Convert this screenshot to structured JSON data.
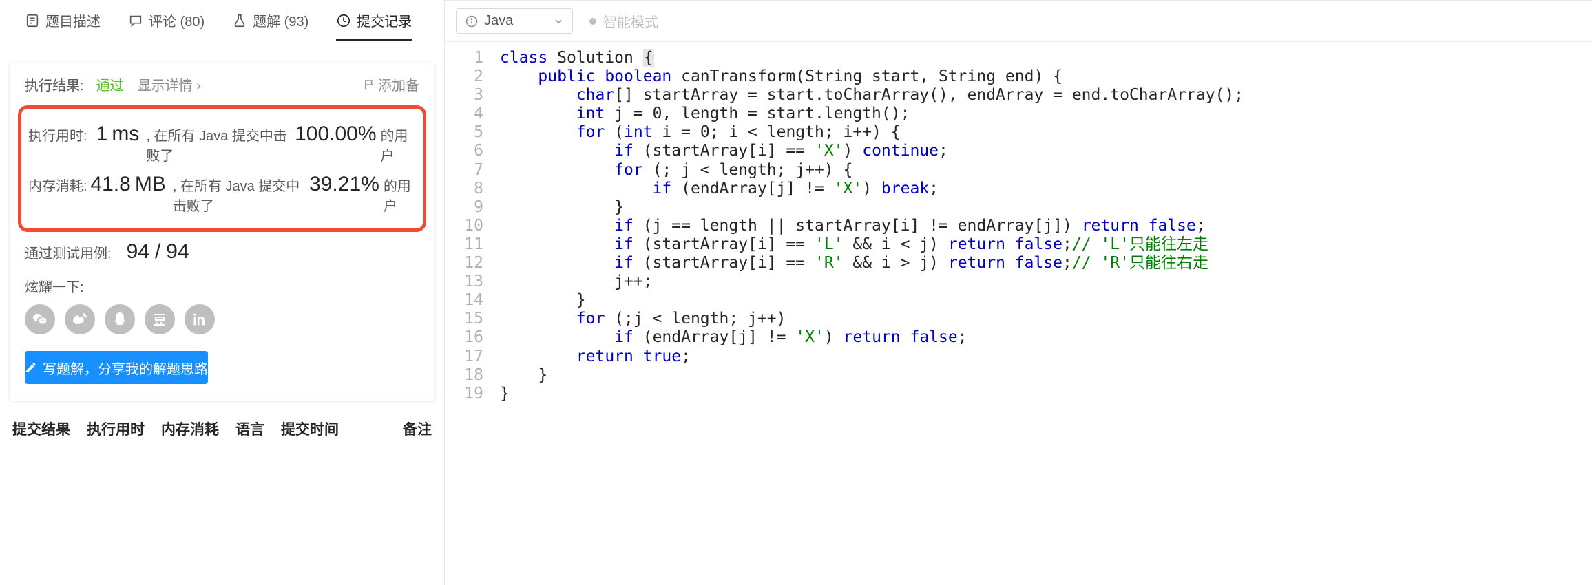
{
  "tabs": {
    "description": "题目描述",
    "comments": "评论 (80)",
    "solutions": "题解 (93)",
    "submissions": "提交记录"
  },
  "result": {
    "exec_label": "执行结果:",
    "status": "通过",
    "detail_link": "显示详情 ›",
    "add_note": "添加备",
    "runtime_label": "执行用时:",
    "runtime_value": "1",
    "runtime_unit": "ms",
    "runtime_text1": ", 在所有 Java 提交中击败了",
    "runtime_pct": "100.00%",
    "runtime_text2": "的用户",
    "memory_label": "内存消耗:",
    "memory_value": "41.8",
    "memory_unit": "MB",
    "memory_text1": ", 在所有 Java 提交中击败了",
    "memory_pct": "39.21%",
    "memory_text2": "的用户",
    "cases_label": "通过测试用例:",
    "cases_passed": "94",
    "cases_sep": "/",
    "cases_total": "94",
    "share_label": "炫耀一下:",
    "write_btn": "写题解，分享我的解题思路"
  },
  "history_columns": {
    "c1": "提交结果",
    "c2": "执行用时",
    "c3": "内存消耗",
    "c4": "语言",
    "c5": "提交时间",
    "c6": "备注"
  },
  "editor": {
    "language": "Java",
    "smart_mode": "智能模式"
  },
  "code_tokens": [
    [
      [
        "class ",
        "k-blue"
      ],
      [
        "Solution ",
        ""
      ],
      [
        "{",
        "k-curs"
      ]
    ],
    [
      [
        "    ",
        ""
      ],
      [
        "public ",
        "k-blue"
      ],
      [
        "boolean ",
        "k-blue"
      ],
      [
        "canTransform(String start, String end) {",
        ""
      ]
    ],
    [
      [
        "        ",
        ""
      ],
      [
        "char",
        "k-blue"
      ],
      [
        "[] startArray = start.toCharArray(), endArray = end.toCharArray();",
        ""
      ]
    ],
    [
      [
        "        ",
        ""
      ],
      [
        "int ",
        "k-blue"
      ],
      [
        "j = ",
        ""
      ],
      [
        "0",
        ""
      ],
      [
        ", length = start.length();",
        ""
      ]
    ],
    [
      [
        "        ",
        ""
      ],
      [
        "for ",
        "k-blue"
      ],
      [
        "(",
        ""
      ],
      [
        "int ",
        "k-blue"
      ],
      [
        "i = ",
        ""
      ],
      [
        "0",
        ""
      ],
      [
        "; i < length; i++) {",
        ""
      ]
    ],
    [
      [
        "            ",
        ""
      ],
      [
        "if ",
        "k-blue"
      ],
      [
        "(startArray[i] == ",
        ""
      ],
      [
        "'X'",
        "k-str"
      ],
      [
        ") ",
        ""
      ],
      [
        "continue",
        "k-blue"
      ],
      [
        ";",
        ""
      ]
    ],
    [
      [
        "            ",
        ""
      ],
      [
        "for ",
        "k-blue"
      ],
      [
        "(; j < length; j++) {",
        ""
      ]
    ],
    [
      [
        "                ",
        ""
      ],
      [
        "if ",
        "k-blue"
      ],
      [
        "(endArray[j] != ",
        ""
      ],
      [
        "'X'",
        "k-str"
      ],
      [
        ") ",
        ""
      ],
      [
        "break",
        "k-blue"
      ],
      [
        ";",
        ""
      ]
    ],
    [
      [
        "            }",
        ""
      ]
    ],
    [
      [
        "            ",
        ""
      ],
      [
        "if ",
        "k-blue"
      ],
      [
        "(j == length || startArray[i] != endArray[j]) ",
        ""
      ],
      [
        "return ",
        "k-blue"
      ],
      [
        "false",
        "k-blue"
      ],
      [
        ";",
        ""
      ]
    ],
    [
      [
        "            ",
        ""
      ],
      [
        "if ",
        "k-blue"
      ],
      [
        "(startArray[i] == ",
        ""
      ],
      [
        "'L'",
        "k-str"
      ],
      [
        " && i < j) ",
        ""
      ],
      [
        "return ",
        "k-blue"
      ],
      [
        "false",
        "k-blue"
      ],
      [
        ";",
        ""
      ],
      [
        "// 'L'只能往左走",
        "k-comment"
      ]
    ],
    [
      [
        "            ",
        ""
      ],
      [
        "if ",
        "k-blue"
      ],
      [
        "(startArray[i] == ",
        ""
      ],
      [
        "'R'",
        "k-str"
      ],
      [
        " && i > j) ",
        ""
      ],
      [
        "return ",
        "k-blue"
      ],
      [
        "false",
        "k-blue"
      ],
      [
        ";",
        ""
      ],
      [
        "// 'R'只能往右走",
        "k-comment"
      ]
    ],
    [
      [
        "            j++;",
        ""
      ]
    ],
    [
      [
        "        }",
        ""
      ]
    ],
    [
      [
        "        ",
        ""
      ],
      [
        "for ",
        "k-blue"
      ],
      [
        "(;j < length; j++)",
        ""
      ]
    ],
    [
      [
        "            ",
        ""
      ],
      [
        "if ",
        "k-blue"
      ],
      [
        "(endArray[j] != ",
        ""
      ],
      [
        "'X'",
        "k-str"
      ],
      [
        ") ",
        ""
      ],
      [
        "return ",
        "k-blue"
      ],
      [
        "false",
        "k-blue"
      ],
      [
        ";",
        ""
      ]
    ],
    [
      [
        "        ",
        ""
      ],
      [
        "return ",
        "k-blue"
      ],
      [
        "true",
        "k-blue"
      ],
      [
        ";",
        ""
      ]
    ],
    [
      [
        "    }",
        ""
      ]
    ],
    [
      [
        "}",
        ""
      ]
    ]
  ]
}
